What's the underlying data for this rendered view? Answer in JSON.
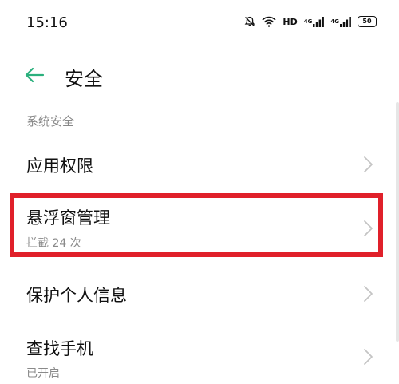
{
  "status_bar": {
    "time": "15:16",
    "hd_label": "HD",
    "signal1_label": "4G",
    "signal2_label": "4G",
    "battery": "50"
  },
  "header": {
    "title": "安全"
  },
  "section": {
    "label": "系统安全"
  },
  "items": [
    {
      "title": "应用权限",
      "subtitle": ""
    },
    {
      "title": "悬浮窗管理",
      "subtitle": "拦截 24 次"
    },
    {
      "title": "保护个人信息",
      "subtitle": ""
    },
    {
      "title": "查找手机",
      "subtitle": "已开启"
    }
  ],
  "colors": {
    "accent": "#2bb07d",
    "highlight": "#e0202a"
  }
}
